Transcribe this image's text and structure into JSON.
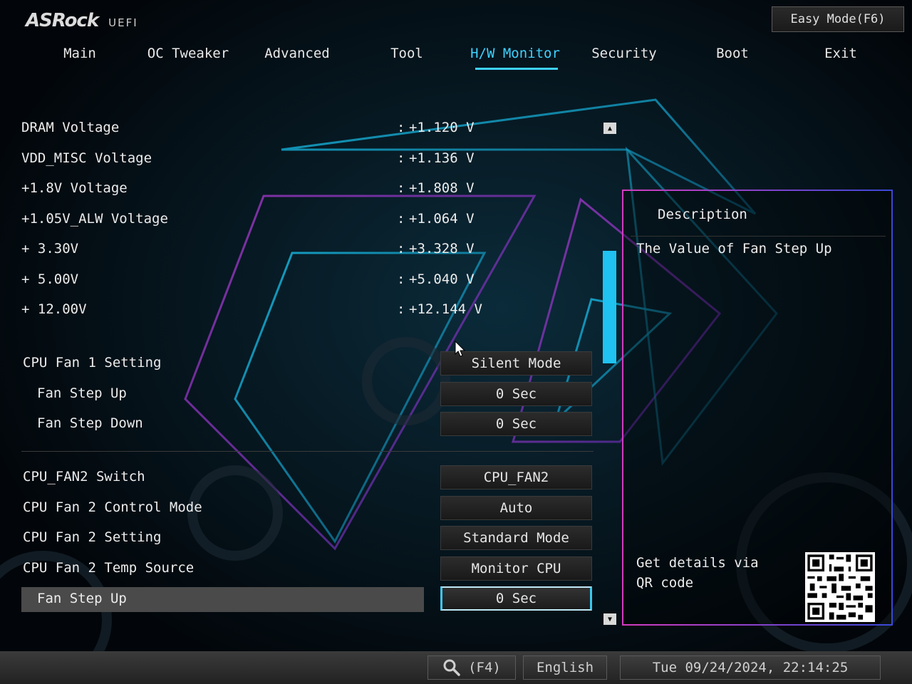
{
  "header": {
    "brand": "ASRock",
    "sub": "UEFI",
    "easy_mode_label": "Easy Mode(F6)"
  },
  "tabs": [
    {
      "label": "Main"
    },
    {
      "label": "OC Tweaker"
    },
    {
      "label": "Advanced"
    },
    {
      "label": "Tool"
    },
    {
      "label": "H/W Monitor",
      "active": true
    },
    {
      "label": "Security"
    },
    {
      "label": "Boot"
    },
    {
      "label": "Exit"
    }
  ],
  "voltages": [
    {
      "label": "DRAM Voltage",
      "sep": ":",
      "value": "+1.120 V"
    },
    {
      "label": "VDD_MISC Voltage",
      "sep": ":",
      "value": "+1.136 V"
    },
    {
      "label": "+1.8V Voltage",
      "sep": ":",
      "value": "+1.808 V"
    },
    {
      "label": "+1.05V_ALW Voltage",
      "sep": ":",
      "value": "+1.064 V"
    },
    {
      "label": "+ 3.30V",
      "sep": ":",
      "value": "+3.328 V"
    },
    {
      "label": "+ 5.00V",
      "sep": ":",
      "value": "+5.040 V"
    },
    {
      "label": "+ 12.00V",
      "sep": ":",
      "value": "+12.144 V"
    }
  ],
  "fan1": [
    {
      "label": "CPU Fan 1 Setting",
      "value": "Silent Mode"
    },
    {
      "label": "Fan Step Up",
      "value": "0 Sec"
    },
    {
      "label": "Fan Step Down",
      "value": "0 Sec"
    }
  ],
  "fan2": [
    {
      "label": "CPU_FAN2 Switch",
      "value": "CPU_FAN2"
    },
    {
      "label": "CPU Fan 2 Control Mode",
      "value": "Auto"
    },
    {
      "label": "CPU Fan 2 Setting",
      "value": "Standard Mode"
    },
    {
      "label": "CPU Fan 2 Temp Source",
      "value": "Monitor CPU"
    },
    {
      "label": "Fan Step Up",
      "value": "0 Sec"
    }
  ],
  "description": {
    "title": "Description",
    "text": "The Value of Fan Step Up",
    "qr_text": "Get details via QR code"
  },
  "footer": {
    "search_key": "(F4)",
    "language": "English",
    "datetime": "Tue 09/24/2024, 22:14:25"
  },
  "colors": {
    "accent": "#3fd2ff",
    "scroll_thumb": "#1fc2f0",
    "border_pink": "#d33cc0",
    "border_blue": "#3a48d8"
  },
  "scroll": {
    "position_fraction": 0.28
  }
}
